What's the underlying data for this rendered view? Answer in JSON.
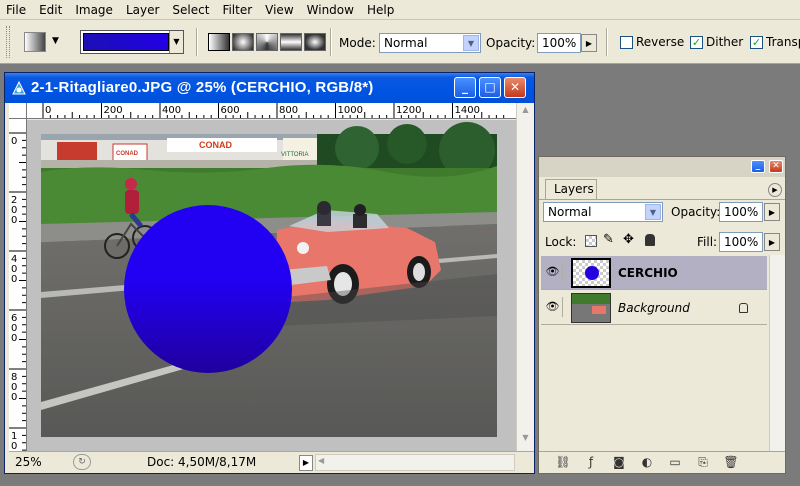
{
  "menu": [
    "File",
    "Edit",
    "Image",
    "Layer",
    "Select",
    "Filter",
    "View",
    "Window",
    "Help"
  ],
  "options": {
    "mode_label": "Mode:",
    "mode_value": "Normal",
    "opacity_label": "Opacity:",
    "opacity_value": "100%",
    "reverse_label": "Reverse",
    "dither_label": "Dither",
    "transparency_label": "Transp",
    "reverse_checked": false,
    "dither_checked": true,
    "transparency_checked": true,
    "gradient_colors": [
      "#1c0fb5",
      "#2300e6"
    ]
  },
  "document": {
    "title": "2-1-Ritagliare0.JPG @ 25% (CERCHIO, RGB/8*)",
    "ruler_h": [
      "0",
      "200",
      "400",
      "600",
      "800",
      "1000",
      "1200",
      "1400"
    ],
    "ruler_v": [
      "0",
      "2",
      "0",
      "0",
      "4",
      "0",
      "0",
      "6",
      "0",
      "0",
      "8",
      "0",
      "0",
      "1",
      "0",
      "0"
    ],
    "zoom": "25%",
    "doc_size": "Doc: 4,50M/8,17M",
    "photo_signs": [
      "CONAD",
      "VITTORIA",
      "CONAD"
    ],
    "circle_colors": [
      "#2200f2",
      "#20009e"
    ]
  },
  "layers_panel": {
    "tab": "Layers",
    "blend_mode": "Normal",
    "opacity_label": "Opacity:",
    "opacity_value": "100%",
    "lock_label": "Lock:",
    "fill_label": "Fill:",
    "fill_value": "100%",
    "layers": [
      {
        "name": "CERCHIO",
        "selected": true,
        "visible": true
      },
      {
        "name": "Background",
        "selected": false,
        "visible": true,
        "locked": true
      }
    ]
  }
}
